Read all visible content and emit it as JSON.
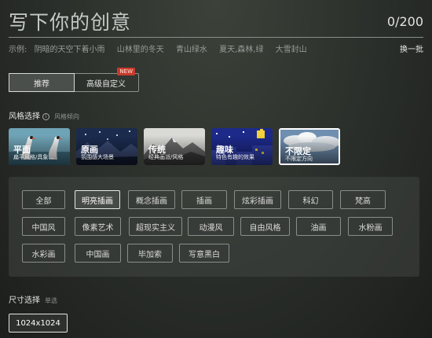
{
  "prompt": {
    "placeholder": "写下你的创意",
    "count": "0/200"
  },
  "examples": {
    "label": "示例:",
    "items": [
      "阴暗的天空下着小雨",
      "山林里的冬天",
      "青山绿水",
      "夏天,森林,绿",
      "大雪封山"
    ],
    "refresh": "换一批"
  },
  "mode_tabs": [
    {
      "label": "推荐",
      "active": true
    },
    {
      "label": "高级自定义",
      "badge": "NEW"
    }
  ],
  "style_section": {
    "title": "风格选择",
    "subtitle": "风格倾向"
  },
  "style_cards": [
    {
      "title": "平面",
      "desc": "扁平风格/具象…"
    },
    {
      "title": "原画",
      "desc": "氛围感大场景"
    },
    {
      "title": "传统",
      "desc": "经典画派/风格"
    },
    {
      "title": "趣味",
      "desc": "特色有趣的效果"
    },
    {
      "title": "不限定",
      "desc": "不限定方向",
      "selected": true
    }
  ],
  "style_tags": [
    [
      "全部",
      "明亮插画",
      "概念插画",
      "插画",
      "炫彩插画",
      "科幻",
      "梵高"
    ],
    [
      "中国风",
      "像素艺术",
      "超现实主义",
      "动漫风",
      "自由风格",
      "油画",
      "水粉画"
    ],
    [
      "水彩画",
      "中国画",
      "毕加索",
      "写意黑白"
    ]
  ],
  "active_tag": "明亮插画",
  "size_section": {
    "title": "尺寸选择",
    "subtitle": "单选",
    "option": "1024x1024"
  }
}
